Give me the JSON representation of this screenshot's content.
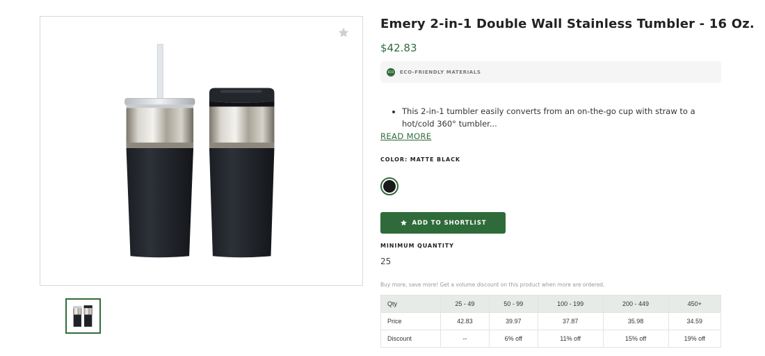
{
  "product": {
    "title": "Emery 2-in-1 Double Wall Stainless Tumbler - 16 Oz.",
    "price": "$42.83",
    "eco_badge": "ECO",
    "eco_text": "ECO-FRIENDLY MATERIALS",
    "bullets": [
      "This 2-in-1 tumbler easily converts from an on-the-go cup with straw to a hot/cold 360° tumbler..."
    ],
    "read_more": "READ MORE",
    "color_label": "COLOR: MATTE BLACK",
    "swatch_color": "#1a1a1a",
    "shortlist_label": "ADD TO SHORTLIST",
    "min_qty_label": "MINIMUM QUANTITY",
    "min_qty_value": "25",
    "volume_note": "Buy more, save more! Get a volume discount on this product when more are ordered."
  },
  "pricing": {
    "rows": [
      [
        "Qty",
        "25 - 49",
        "50 - 99",
        "100 - 199",
        "200 - 449",
        "450+"
      ],
      [
        "Price",
        "42.83",
        "39.97",
        "37.87",
        "35.98",
        "34.59"
      ],
      [
        "Discount",
        "--",
        "6% off",
        "11% off",
        "15% off",
        "19% off"
      ]
    ]
  },
  "icons": {
    "favorite": "star-icon",
    "shortlist": "star-icon"
  },
  "colors": {
    "accent": "#2f6b3a",
    "table_header_bg": "#e6ebe7"
  }
}
